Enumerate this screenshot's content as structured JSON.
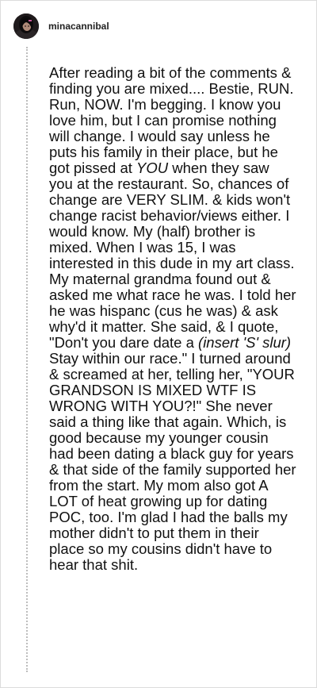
{
  "post": {
    "username": "minacannibal",
    "avatar_icon": "user-avatar-photo",
    "body": {
      "t1": "After reading a bit of the comments & finding you are mixed.... Bestie, RUN. Run, NOW. I'm begging. I know you love him, but I can promise nothing will change. I would say unless he puts his family in their place, but he got pissed at ",
      "e1": "YOU",
      "t2": " when they saw you at the restaurant. So, chances of change are VERY SLIM. & kids won't change racist behavior/views either. I would know. My (half) brother is mixed. When I was 15, I was interested in this dude in my art class. My maternal grandma found out & asked me what race he was. I told her he was hispanc (cus he was) & ask why'd it matter. She said, & I quote, \"Don't you dare date a ",
      "e2": "(insert 'S' slur)",
      "t3": " Stay within our race.\" I turned around & screamed at her, telling her, \"YOUR GRANDSON IS MIXED WTF IS WRONG WITH YOU?!\" She never said a thing like that again. Which, is good because my younger cousin had been dating a black guy for years & that side of the family supported her from the start. My mom also got A LOT of heat growing up for dating POC, too. I'm glad I had the balls my mother didn't to put them in their place so my cousins didn't have to hear that shit."
    }
  }
}
